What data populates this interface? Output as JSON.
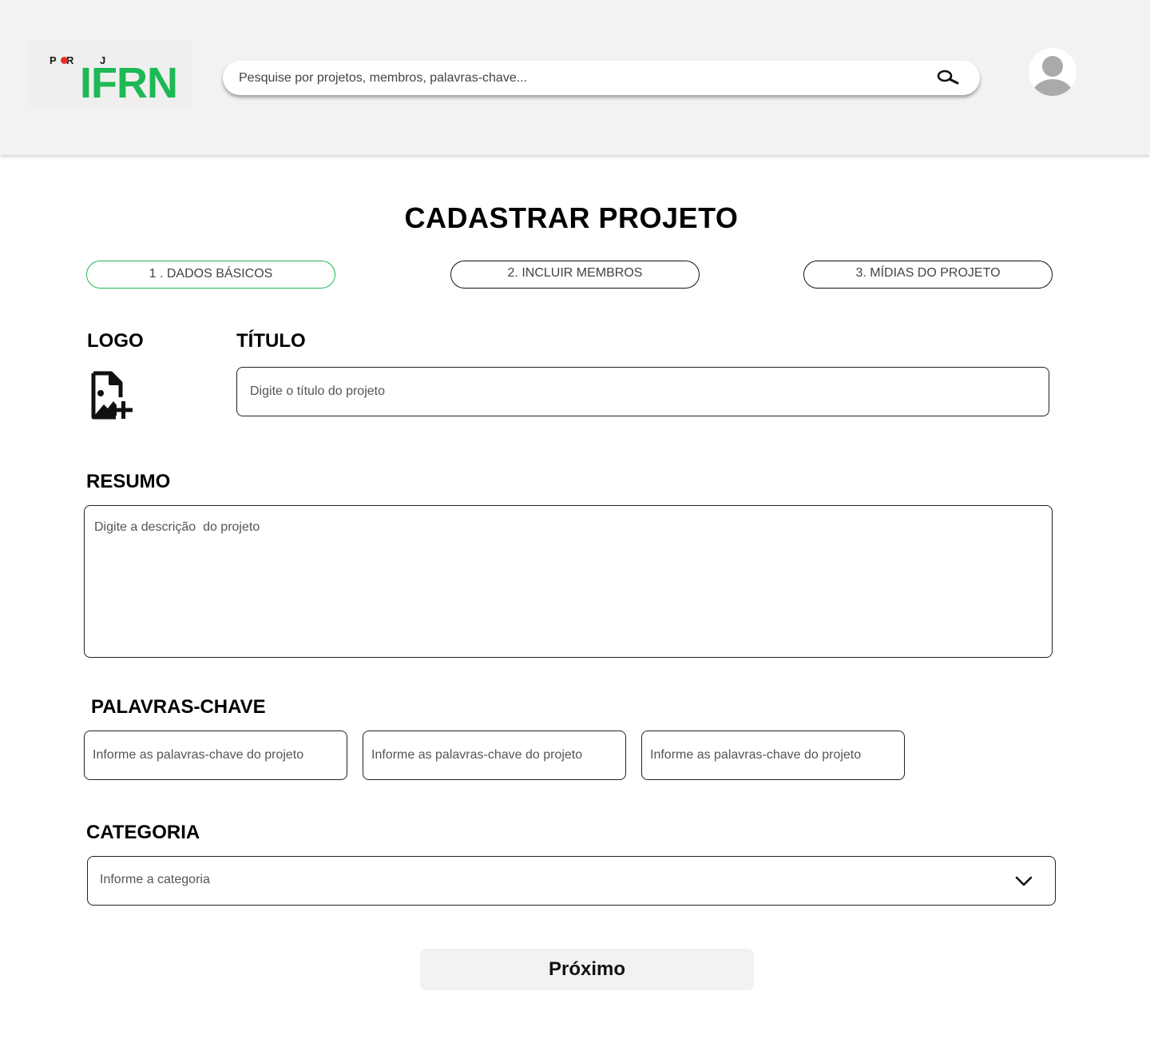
{
  "header": {
    "logo": {
      "prefix_letters": [
        "P",
        "R",
        "J"
      ],
      "name": "IFRN",
      "brand_color": "#1db954",
      "dot_color": "#e4312b"
    },
    "search": {
      "placeholder": "Pesquise por projetos, membros, palavras-chave...",
      "icon": "search-icon"
    },
    "avatar": {
      "icon": "user-avatar-icon"
    }
  },
  "page": {
    "title": "CADASTRAR PROJETO"
  },
  "steps": [
    {
      "label": "1 . DADOS BÁSICOS",
      "active": true
    },
    {
      "label": "2. INCLUIR MEMBROS",
      "active": false
    },
    {
      "label": "3. MÍDIAS DO PROJETO",
      "active": false
    }
  ],
  "form": {
    "logo": {
      "label": "LOGO",
      "icon": "add-image-icon"
    },
    "title": {
      "label": "TÍTULO",
      "placeholder": "Digite o título do projeto"
    },
    "summary": {
      "label": "RESUMO",
      "placeholder": "Digite a descrição  do projeto"
    },
    "keywords": {
      "label": "PALAVRAS-CHAVE",
      "fields": [
        {
          "placeholder": "Informe as palavras-chave do projeto"
        },
        {
          "placeholder": "Informe as palavras-chave do projeto"
        },
        {
          "placeholder": "Informe as palavras-chave do projeto"
        }
      ]
    },
    "category": {
      "label": "CATEGORIA",
      "value": "Informe a categoria",
      "icon": "chevron-down-icon"
    }
  },
  "actions": {
    "next_label": "Próximo"
  }
}
